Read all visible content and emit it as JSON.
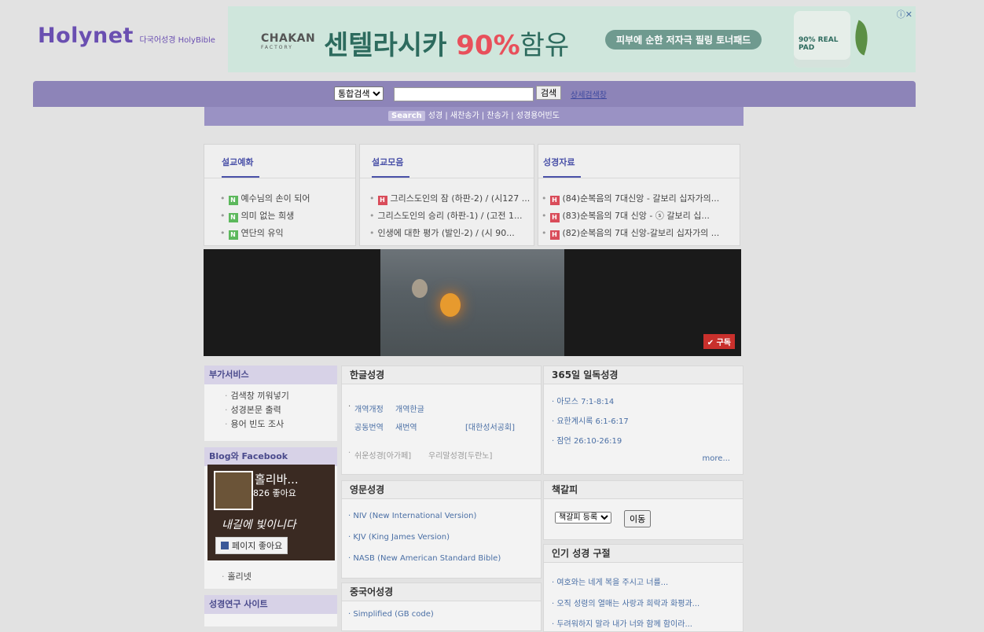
{
  "header": {
    "brand": "Holynet",
    "brand_sub": "다국어성경 HolyBible"
  },
  "ad": {
    "brand": "CHAKAN",
    "brand_sub": "FACTORY",
    "headline": "센텔라시카 ",
    "percent": "90%",
    "suffix": "함유",
    "pill": "피부에 순한 저자극 필링 토너패드",
    "jar_label": "90% REAL PAD",
    "close": "ⓘ✕"
  },
  "search": {
    "select_value": "통합검색",
    "button": "검색",
    "advanced": "상세검색창"
  },
  "subbar": {
    "tag": "Search",
    "links": "성경 | 새찬송가 | 찬송가 | 성경용어빈도"
  },
  "sermon_illust": {
    "title": "설교예화",
    "items": [
      {
        "badge": "N",
        "text": "예수님의 손이 되어"
      },
      {
        "badge": "N",
        "text": "의미 없는 희생"
      },
      {
        "badge": "N",
        "text": "연단의 유익"
      }
    ]
  },
  "sermon_collection": {
    "title": "설교모음",
    "items": [
      {
        "badge": "H",
        "text": "그리스도인의 잠 (하판-2) / (시127 ..."
      },
      {
        "badge": "",
        "text": "그리스도인의 승리 (하판-1) / (고전 1..."
      },
      {
        "badge": "",
        "text": "인생에 대한 평가 (발인-2) / (시 90..."
      }
    ]
  },
  "bible_materials": {
    "title": "성경자료",
    "items": [
      {
        "badge": "H",
        "text": "(84)순복음의 7대신앙 - 갈보리 십자가의..."
      },
      {
        "badge": "H",
        "text": "(83)순복음의 7대 신앙 - ⓢ 갈보리 십..."
      },
      {
        "badge": "H",
        "text": "(82)순복음의 7대 신앙-갈보리 십자가의 ..."
      }
    ]
  },
  "video": {
    "subscribe": "✔ 구독"
  },
  "extra_services": {
    "title": "부가서비스",
    "items": [
      "검색창 끼워넣기",
      "성경본문 출력",
      "용어 빈도 조사"
    ]
  },
  "blog": {
    "title": "Blog와 Facebook",
    "page_name": "홀리바...",
    "likes": "826 좋아요",
    "script_text": "내길에 빛이니다",
    "like_button": "페이지 좋아요",
    "link": "홀리넷"
  },
  "research": {
    "title": "성경연구 사이트"
  },
  "korean_bible": {
    "title": "한글성경",
    "row1a": "개역개정",
    "row1b": "개역한글",
    "row2a": "공동번역",
    "row2b": "새번역",
    "row2c": "[대한성서공회]",
    "row3a": "쉬운성경[아가페]",
    "row3b": "우리말성경[두란노]"
  },
  "daily_reading": {
    "title": "365일 일독성경",
    "items": [
      "아모스 7:1-8:14",
      "요한계시록 6:1-6:17",
      "잠언 26:10-26:19"
    ],
    "more": "more..."
  },
  "english_bible": {
    "title": "영문성경",
    "items": [
      "NIV (New International Version)",
      "KJV (King James Version)",
      "NASB (New American Standard Bible)"
    ]
  },
  "bookmark": {
    "title": "책갈피",
    "select_value": "책갈피 등록",
    "button": "이동"
  },
  "chinese_bible": {
    "title": "중국어성경",
    "items": [
      "Simplified (GB code)"
    ]
  },
  "popular_verses": {
    "title": "인기 성경 구절",
    "items": [
      "여호와는 네게 복을 주시고 너를...",
      "오직 성령의 열매는 사랑과 희락과 화평과...",
      "두려워하지 말라 내가 너와 함께 함이라..."
    ]
  },
  "colors": {
    "brand": "#6a4fb1",
    "bar": "#8d84b8",
    "link": "#4a6fa5",
    "heading": "#4a51a8"
  }
}
